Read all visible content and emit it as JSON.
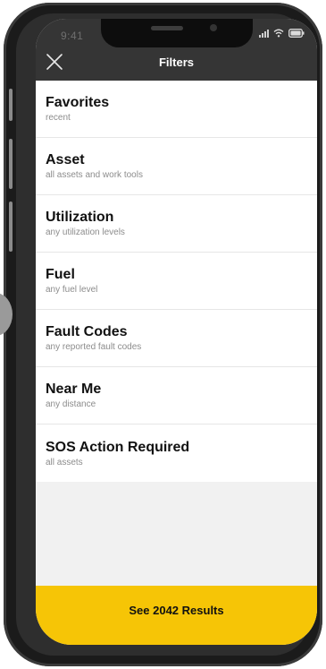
{
  "status_bar": {
    "time": "9:41"
  },
  "header": {
    "title": "Filters",
    "close_icon": "close-x-icon"
  },
  "filters": [
    {
      "label": "Favorites",
      "subtitle": "recent"
    },
    {
      "label": "Asset",
      "subtitle": "all assets and work tools"
    },
    {
      "label": "Utilization",
      "subtitle": "any utilization levels"
    },
    {
      "label": "Fuel",
      "subtitle": "any fuel level"
    },
    {
      "label": "Fault Codes",
      "subtitle": "any reported fault codes"
    },
    {
      "label": "Near Me",
      "subtitle": "any distance"
    },
    {
      "label": "SOS Action Required",
      "subtitle": "all assets"
    }
  ],
  "results_button": {
    "label": "See 2042 Results"
  },
  "colors": {
    "accent": "#f6c506",
    "header_bg": "#353535",
    "list_bg": "#ffffff",
    "empty_bg": "#f1f1f1"
  }
}
